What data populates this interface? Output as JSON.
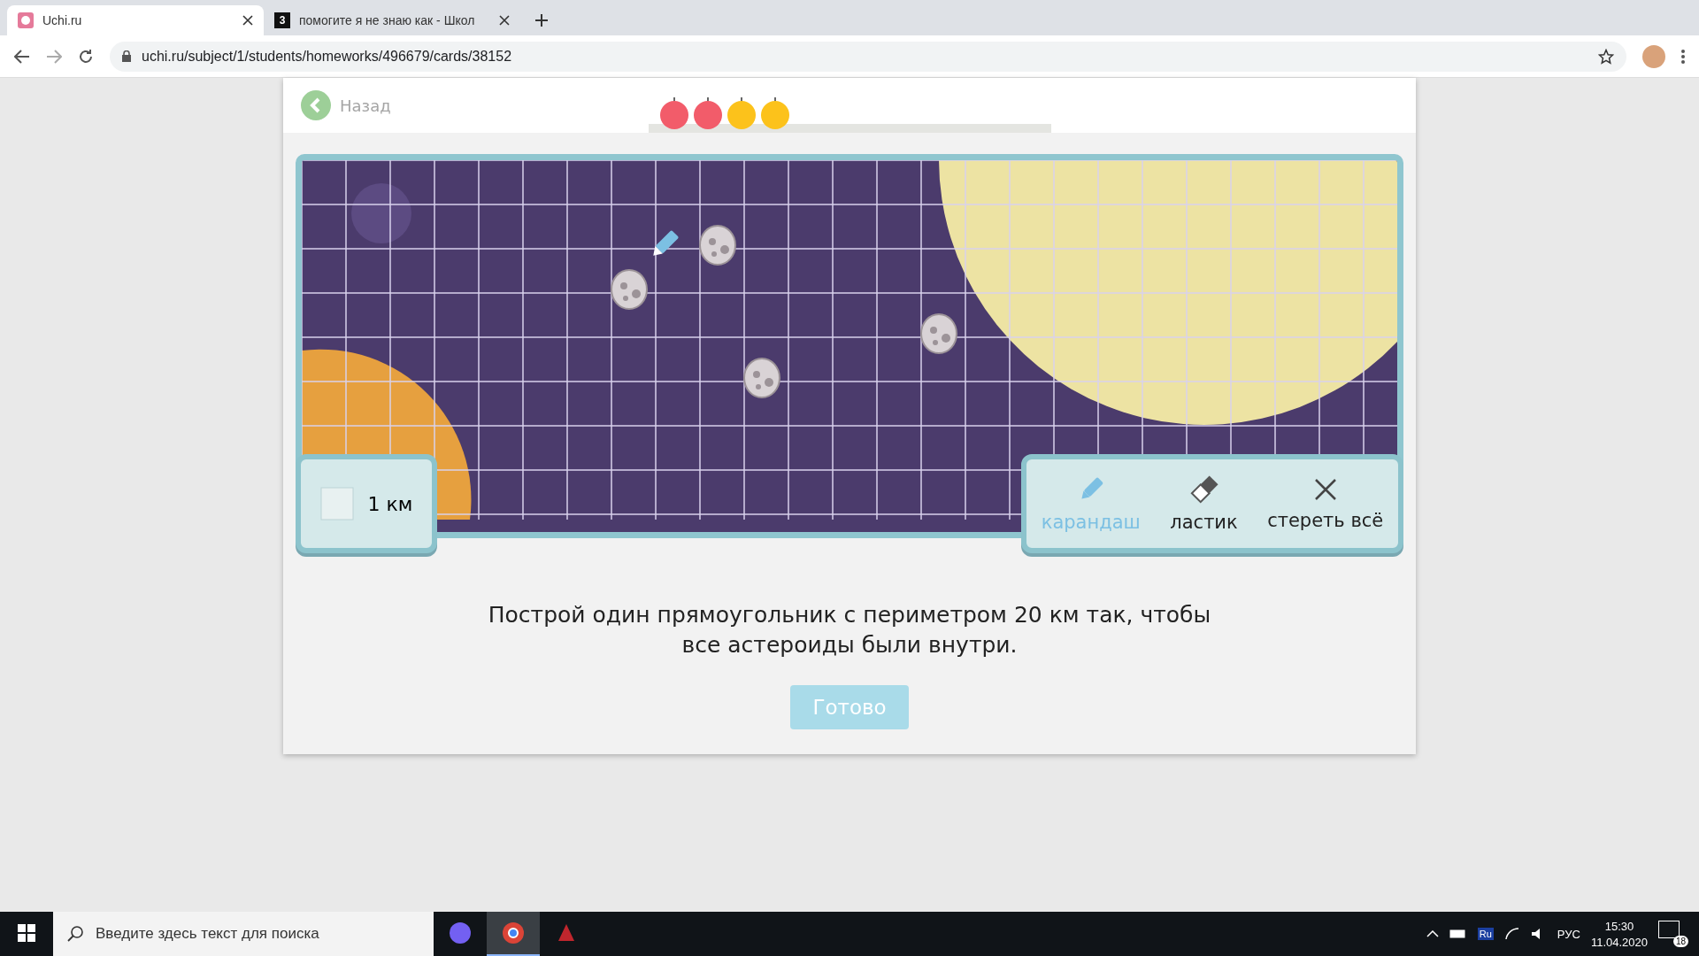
{
  "browser": {
    "tabs": [
      {
        "kind": "uchi",
        "title": "Uchi.ru",
        "selected": true
      },
      {
        "kind": "znanija",
        "icon_text": "3",
        "title": "помогите я не знаю как - Школ",
        "selected": false
      }
    ],
    "address": "uchi.ru/subject/1/students/homeworks/496679/cards/38152"
  },
  "card": {
    "back": "Назад",
    "apples": [
      {
        "color": "#f25c6a"
      },
      {
        "color": "#f25c6a"
      },
      {
        "color": "#fcc21b"
      },
      {
        "color": "#fcc21b"
      }
    ],
    "scale": {
      "label": "1 км"
    },
    "tools": [
      {
        "kind": "pencil",
        "label": "карандаш",
        "selected": true
      },
      {
        "kind": "eraser",
        "label": "ластик",
        "selected": false
      },
      {
        "kind": "clear",
        "label": "стереть всё",
        "selected": false
      }
    ],
    "instruction": "Построй один прямоугольник с периметром 20 км так, чтобы все астероиды были внутри.",
    "submit": {
      "label": "Готово",
      "disabled": true
    }
  },
  "taskbar": {
    "search_placeholder": "Введите здесь текст для поиска",
    "lang_icon": "Ru",
    "language": "РУС",
    "time": "15:30",
    "date": "11.04.2020",
    "notifications": "18"
  }
}
